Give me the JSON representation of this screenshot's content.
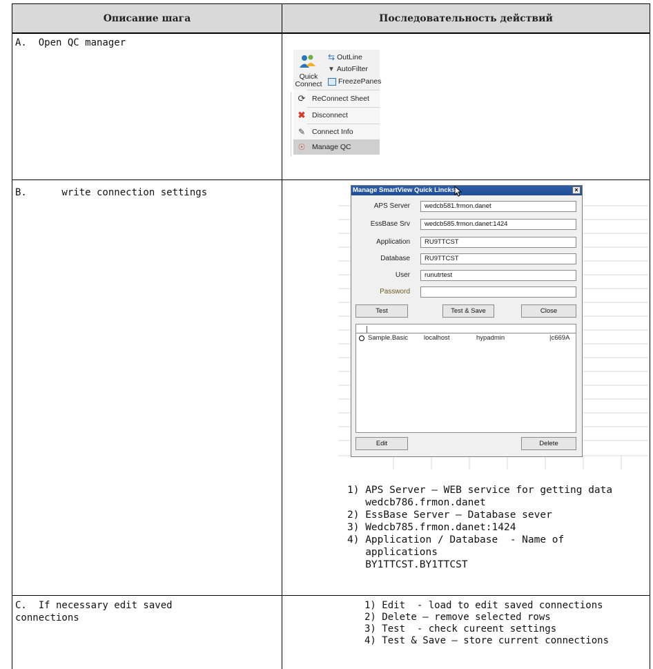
{
  "table": {
    "header": {
      "col1": "Описание шага",
      "col2": "Последовательность действий"
    },
    "rows": [
      {
        "step": "A.  Open QC manager"
      },
      {
        "step": "B.      write connection settings",
        "notes": [
          "1) APS Server – WEB service for getting data",
          "   wedcb786.frmon.danet",
          "2) EssBase Server – Database sever",
          "3) Wedcb785.frmon.danet:1424",
          "4) Application / Database  - Name of",
          "   applications",
          "   BY1TTCST.BY1TTCST"
        ]
      },
      {
        "step_line1": "C.  If necessary edit saved",
        "step_line2": "connections",
        "notes": [
          "1) Edit  - load to edit saved connections",
          "2) Delete – remove selected rows",
          "3) Test  - check cureent settings",
          "4) Test & Save – store current connections"
        ]
      }
    ]
  },
  "ribbon": {
    "quick_connect_line1": "Quick",
    "quick_connect_line2": "Connect",
    "outline": "OutLine",
    "autofilter": "AutoFilter",
    "freezepanes": "FreezePanes",
    "menu": [
      {
        "label": "ReConnect Sheet",
        "icon": "reconnect-icon"
      },
      {
        "label": "Disconnect",
        "icon": "disconnect-icon"
      },
      {
        "label": "Connect Info",
        "icon": "connect-info-icon"
      },
      {
        "label": "Manage QC",
        "icon": "manage-qc-icon"
      }
    ]
  },
  "dialog": {
    "title": "Manage SmartView Quick Lincks",
    "close_glyph": "×",
    "fields": [
      {
        "label": "APS Server",
        "value": "wedcb581.frmon.danet"
      },
      {
        "label": "EssBase Srv",
        "value": "wedcb585.frmon.danet:1424"
      },
      {
        "label": "Application",
        "value": "RU9TTCST"
      },
      {
        "label": "Database",
        "value": "RU9TTCST"
      },
      {
        "label": "User",
        "value": "runutrtest"
      },
      {
        "label": "Password",
        "value": ""
      }
    ],
    "buttons": {
      "test": "Test",
      "test_save": "Test & Save",
      "close": "Close",
      "edit": "Edit",
      "delete": "Delete"
    },
    "list_row": {
      "name": "Sample.Basic",
      "host": "localhost",
      "user": "hypadmin",
      "id": "|c669A"
    }
  },
  "colors": {
    "header_bg": "#d9d9d9",
    "dialog_title": "#1f4d96",
    "manage_qc_highlight": "#cfcfcf",
    "password_label": "#6b5a1e"
  }
}
